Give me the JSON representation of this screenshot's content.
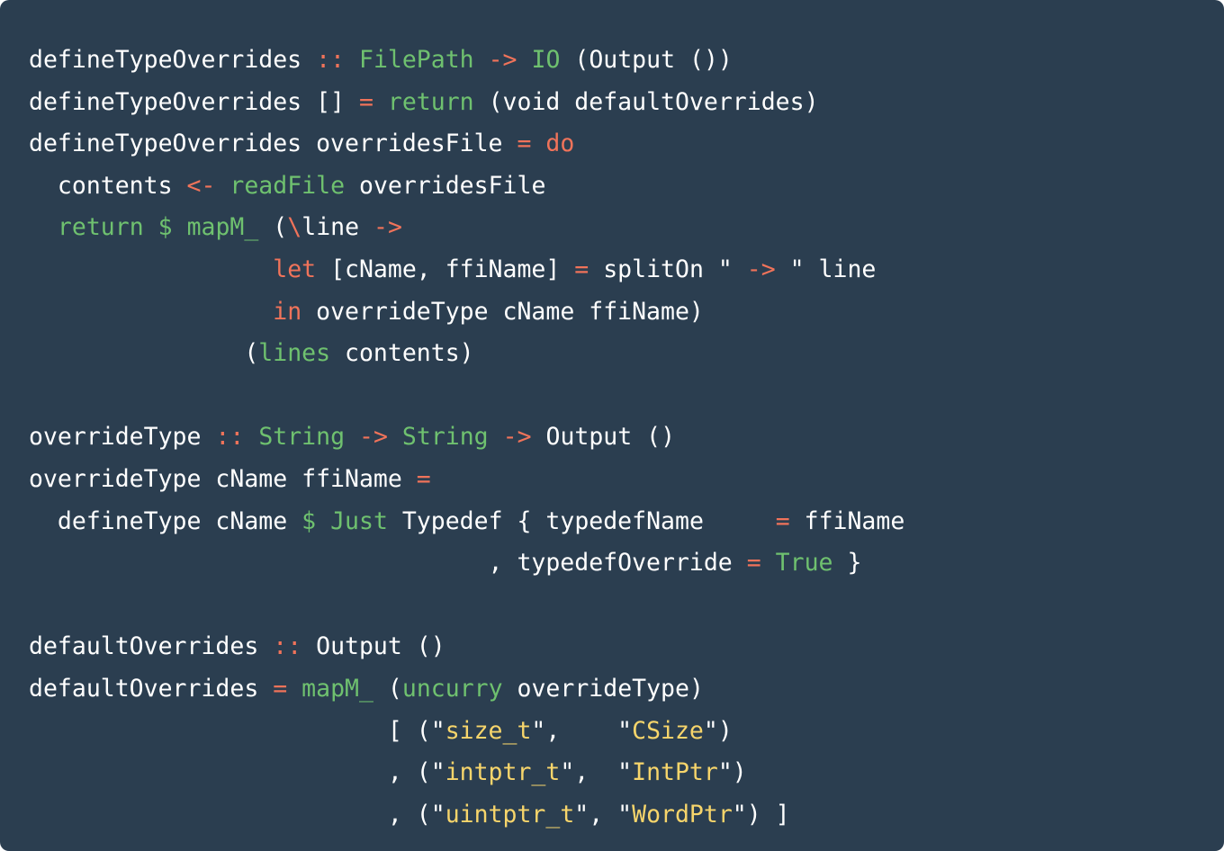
{
  "editor": {
    "language": "haskell",
    "colors": {
      "background": "#2b3e50",
      "plain": "#ffffff",
      "operator_keyword": "#f0735a",
      "type_function": "#6fc16f",
      "string": "#f7d56b"
    },
    "lines": [
      [
        [
          "plain",
          "defineTypeOverrides "
        ],
        [
          "op",
          "::"
        ],
        [
          "plain",
          " "
        ],
        [
          "type",
          "FilePath"
        ],
        [
          "plain",
          " "
        ],
        [
          "op",
          "->"
        ],
        [
          "plain",
          " "
        ],
        [
          "type",
          "IO"
        ],
        [
          "plain",
          " (Output ())"
        ]
      ],
      [
        [
          "plain",
          "defineTypeOverrides [] "
        ],
        [
          "op",
          "="
        ],
        [
          "plain",
          " "
        ],
        [
          "fn",
          "return"
        ],
        [
          "plain",
          " (void defaultOverrides)"
        ]
      ],
      [
        [
          "plain",
          "defineTypeOverrides overridesFile "
        ],
        [
          "op",
          "="
        ],
        [
          "plain",
          " "
        ],
        [
          "kw",
          "do"
        ]
      ],
      [
        [
          "plain",
          "  contents "
        ],
        [
          "op",
          "<-"
        ],
        [
          "plain",
          " "
        ],
        [
          "fn",
          "readFile"
        ],
        [
          "plain",
          " overridesFile"
        ]
      ],
      [
        [
          "plain",
          "  "
        ],
        [
          "fn",
          "return"
        ],
        [
          "plain",
          " "
        ],
        [
          "fn",
          "$"
        ],
        [
          "plain",
          " "
        ],
        [
          "fn",
          "mapM_"
        ],
        [
          "plain",
          " ("
        ],
        [
          "op",
          "\\"
        ],
        [
          "plain",
          "line "
        ],
        [
          "op",
          "->"
        ]
      ],
      [
        [
          "plain",
          "                 "
        ],
        [
          "kw",
          "let"
        ],
        [
          "plain",
          " [cName, ffiName] "
        ],
        [
          "op",
          "="
        ],
        [
          "plain",
          " splitOn \" "
        ],
        [
          "op",
          "->"
        ],
        [
          "plain",
          " \" line"
        ]
      ],
      [
        [
          "plain",
          "                 "
        ],
        [
          "kw",
          "in"
        ],
        [
          "plain",
          " overrideType cName ffiName)"
        ]
      ],
      [
        [
          "plain",
          "               ("
        ],
        [
          "fn",
          "lines"
        ],
        [
          "plain",
          " contents)"
        ]
      ],
      [],
      [
        [
          "plain",
          "overrideType "
        ],
        [
          "op",
          "::"
        ],
        [
          "plain",
          " "
        ],
        [
          "type",
          "String"
        ],
        [
          "plain",
          " "
        ],
        [
          "op",
          "->"
        ],
        [
          "plain",
          " "
        ],
        [
          "type",
          "String"
        ],
        [
          "plain",
          " "
        ],
        [
          "op",
          "->"
        ],
        [
          "plain",
          " Output ()"
        ]
      ],
      [
        [
          "plain",
          "overrideType cName ffiName "
        ],
        [
          "op",
          "="
        ]
      ],
      [
        [
          "plain",
          "  defineType cName "
        ],
        [
          "fn",
          "$"
        ],
        [
          "plain",
          " "
        ],
        [
          "type",
          "Just"
        ],
        [
          "plain",
          " Typedef { typedefName     "
        ],
        [
          "op",
          "="
        ],
        [
          "plain",
          " ffiName"
        ]
      ],
      [
        [
          "plain",
          "                                , typedefOverride "
        ],
        [
          "op",
          "="
        ],
        [
          "plain",
          " "
        ],
        [
          "type",
          "True"
        ],
        [
          "plain",
          " }"
        ]
      ],
      [],
      [
        [
          "plain",
          "defaultOverrides "
        ],
        [
          "op",
          "::"
        ],
        [
          "plain",
          " Output ()"
        ]
      ],
      [
        [
          "plain",
          "defaultOverrides "
        ],
        [
          "op",
          "="
        ],
        [
          "plain",
          " "
        ],
        [
          "fn",
          "mapM_"
        ],
        [
          "plain",
          " ("
        ],
        [
          "fn",
          "uncurry"
        ],
        [
          "plain",
          " overrideType)"
        ]
      ],
      [
        [
          "plain",
          "                         [ (\""
        ],
        [
          "str",
          "size_t"
        ],
        [
          "plain",
          "\",    \""
        ],
        [
          "str",
          "CSize"
        ],
        [
          "plain",
          "\")"
        ]
      ],
      [
        [
          "plain",
          "                         , (\""
        ],
        [
          "str",
          "intptr_t"
        ],
        [
          "plain",
          "\",  \""
        ],
        [
          "str",
          "IntPtr"
        ],
        [
          "plain",
          "\")"
        ]
      ],
      [
        [
          "plain",
          "                         , (\""
        ],
        [
          "str",
          "uintptr_t"
        ],
        [
          "plain",
          "\", \""
        ],
        [
          "str",
          "WordPtr"
        ],
        [
          "plain",
          "\") ]"
        ]
      ]
    ]
  }
}
